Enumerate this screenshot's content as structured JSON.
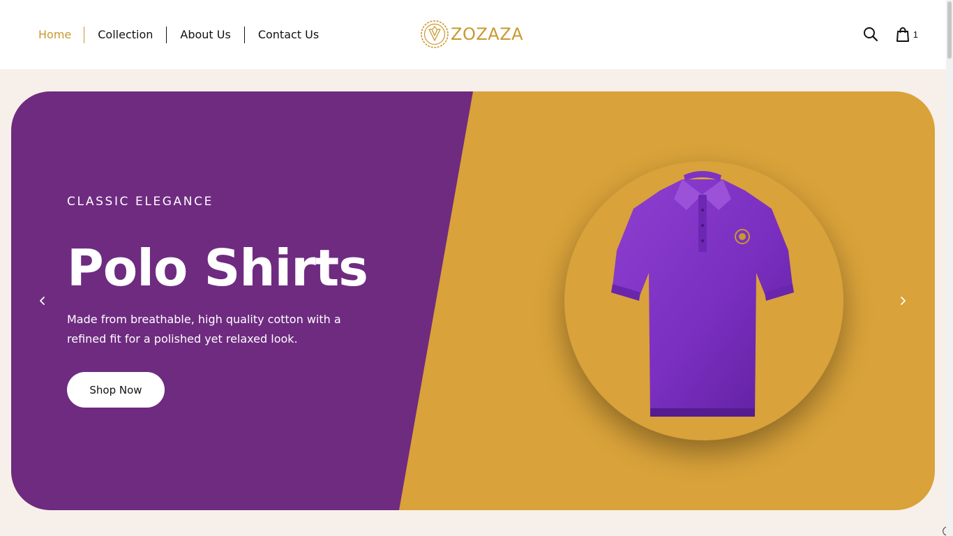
{
  "header": {
    "nav": [
      {
        "label": "Home",
        "active": true
      },
      {
        "label": "Collection"
      },
      {
        "label": "About Us"
      },
      {
        "label": "Contact Us"
      }
    ],
    "brand": "ZOZAZA",
    "cart_count": "1",
    "icons": [
      "search-icon",
      "shopping-bag-icon"
    ]
  },
  "hero": {
    "eyebrow": "CLASSIC ELEGANCE",
    "title": "Polo Shirts",
    "description": "Made from breathable, high quality cotton with a refined fit for a polished yet relaxed look.",
    "cta_label": "Shop Now",
    "product_image": "purple-polo-shirt",
    "controls": [
      "chevron-left-icon",
      "chevron-right-icon"
    ]
  },
  "colors": {
    "accent_gold": "#c9982e",
    "slide_gold": "#d9a23a",
    "slide_purple": "#6e2b80",
    "page_background": "#f7f0ea",
    "text_dark": "#111111"
  }
}
